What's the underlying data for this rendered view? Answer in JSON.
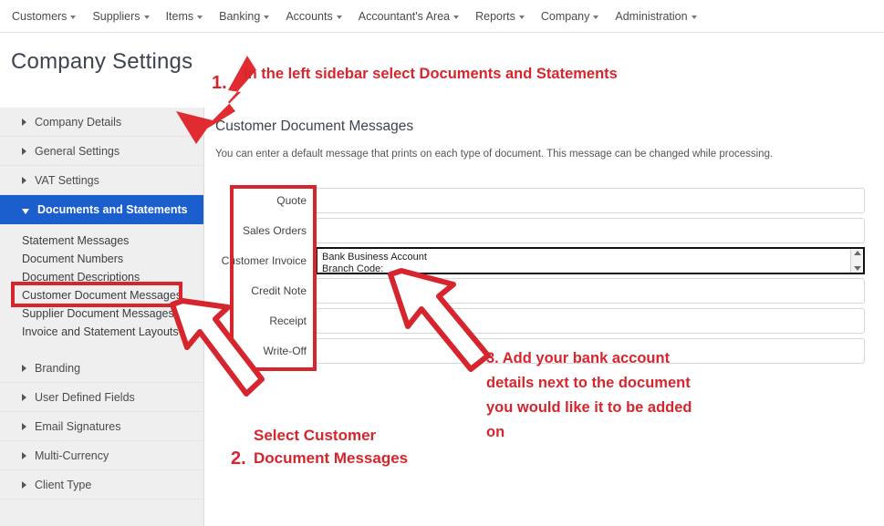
{
  "menubar": {
    "items": [
      {
        "label": "Customers",
        "icon": "chevron-down-icon"
      },
      {
        "label": "Suppliers",
        "icon": "chevron-down-icon"
      },
      {
        "label": "Items",
        "icon": "chevron-down-icon"
      },
      {
        "label": "Banking",
        "icon": "chevron-down-icon"
      },
      {
        "label": "Accounts",
        "icon": "chevron-down-icon"
      },
      {
        "label": "Accountant's Area",
        "icon": "chevron-down-icon"
      },
      {
        "label": "Reports",
        "icon": "chevron-down-icon"
      },
      {
        "label": "Company",
        "icon": "chevron-down-icon"
      },
      {
        "label": "Administration",
        "icon": "chevron-down-icon"
      }
    ]
  },
  "page": {
    "title": "Company Settings"
  },
  "sidebar": {
    "groups": [
      {
        "label": "Company Details",
        "expanded": false,
        "icon": "triangle-right-icon"
      },
      {
        "label": "General Settings",
        "expanded": false,
        "icon": "triangle-right-icon"
      },
      {
        "label": "VAT Settings",
        "expanded": false,
        "icon": "triangle-right-icon"
      },
      {
        "label": "Documents and Statements",
        "expanded": true,
        "icon": "triangle-down-icon"
      }
    ],
    "sub_items": [
      "Statement Messages",
      "Document Numbers",
      "Document Descriptions",
      "Customer Document Messages",
      "Supplier Document Messages",
      "Invoice and Statement Layouts"
    ],
    "selected_sub_item": "Customer Document Messages",
    "groups_lower": [
      {
        "label": "Branding",
        "expanded": false,
        "icon": "triangle-right-icon"
      },
      {
        "label": "User Defined Fields",
        "expanded": false,
        "icon": "triangle-right-icon"
      },
      {
        "label": "Email Signatures",
        "expanded": false,
        "icon": "triangle-right-icon"
      },
      {
        "label": "Multi-Currency",
        "expanded": false,
        "icon": "triangle-right-icon"
      },
      {
        "label": "Client Type",
        "expanded": false,
        "icon": "triangle-right-icon"
      }
    ]
  },
  "main": {
    "heading": "Customer Document Messages",
    "description": "You can enter a default message that prints on each type of document. This message can be changed while processing.",
    "fields": [
      {
        "label": "Quote",
        "value": "",
        "type": "input"
      },
      {
        "label": "Sales Orders",
        "value": "",
        "type": "input"
      },
      {
        "label": "Customer Invoice",
        "value": "Bank Business Account\nBranch Code:",
        "type": "textarea",
        "focused": true,
        "scrollbar": true
      },
      {
        "label": "Credit Note",
        "value": "",
        "type": "input"
      },
      {
        "label": "Receipt",
        "value": "",
        "type": "input"
      },
      {
        "label": "Write-Off",
        "value": "",
        "type": "input"
      }
    ]
  },
  "annotations": {
    "accent_color": "#d6252d",
    "step1_number": "1.",
    "step1_text": "In the left sidebar select Documents and Statements",
    "step2_number": "2.",
    "step2_line1": "Select Customer",
    "step2_line2": "Document Messages",
    "step3_line1": "3. Add your bank account",
    "step3_line2": "details next to the document",
    "step3_line3": "you would like it to be added",
    "step3_line4": "on"
  },
  "colors": {
    "sidebar_active_blue": "#1b5fcf",
    "annotation_red": "#d6252d",
    "sidebar_bg": "#efefef"
  }
}
